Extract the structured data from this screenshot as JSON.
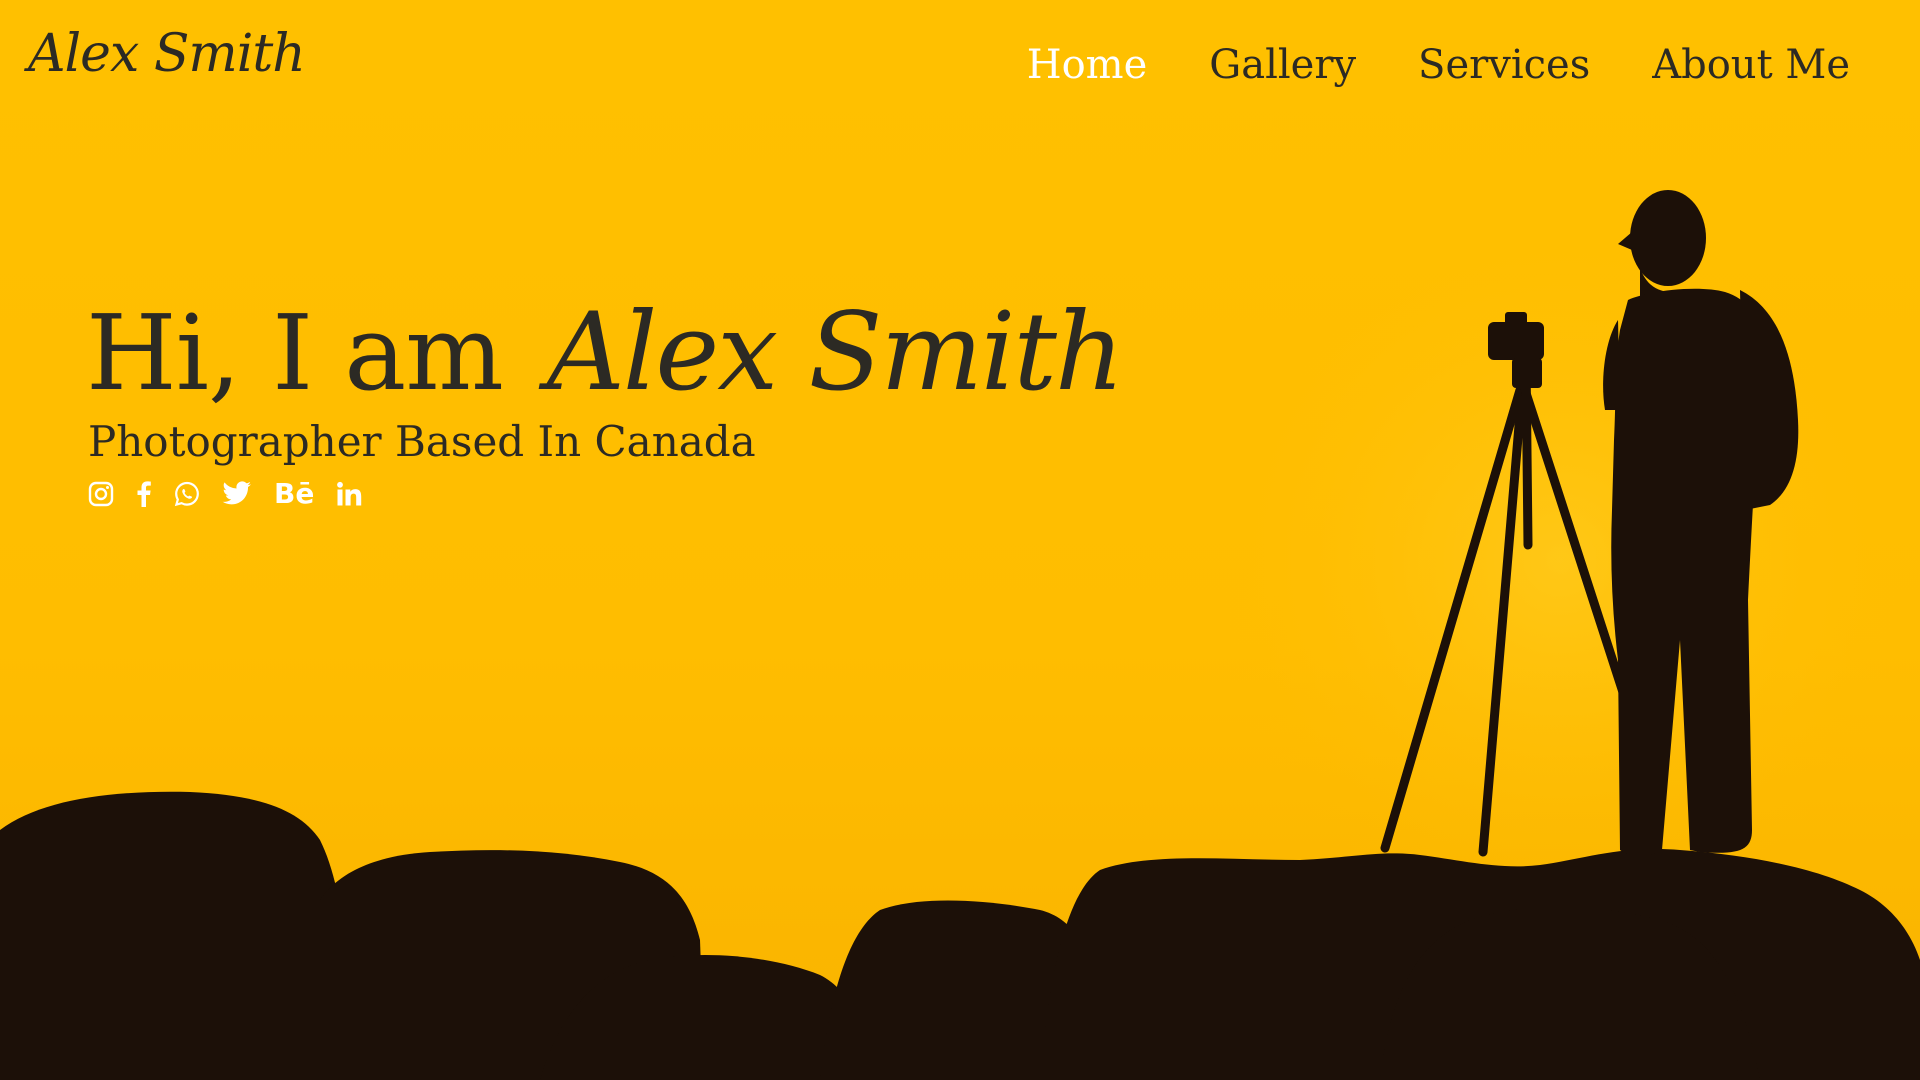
{
  "header": {
    "logo": "Alex Smith",
    "nav": [
      {
        "label": "Home",
        "active": true
      },
      {
        "label": "Gallery",
        "active": false
      },
      {
        "label": "Services",
        "active": false
      },
      {
        "label": "About Me",
        "active": false
      }
    ]
  },
  "hero": {
    "greeting": "Hi, I am",
    "name": "Alex Smith",
    "subtitle": "Photographer Based In Canada",
    "social": [
      {
        "icon": "instagram-icon"
      },
      {
        "icon": "facebook-icon"
      },
      {
        "icon": "whatsapp-icon"
      },
      {
        "icon": "twitter-icon"
      },
      {
        "icon": "behance-icon",
        "text": "Bē"
      },
      {
        "icon": "linkedin-icon"
      }
    ]
  },
  "colors": {
    "background": "#ffbf00",
    "text": "#2c2a24",
    "active_nav": "#ffffff",
    "silhouette": "#1a0f08"
  }
}
